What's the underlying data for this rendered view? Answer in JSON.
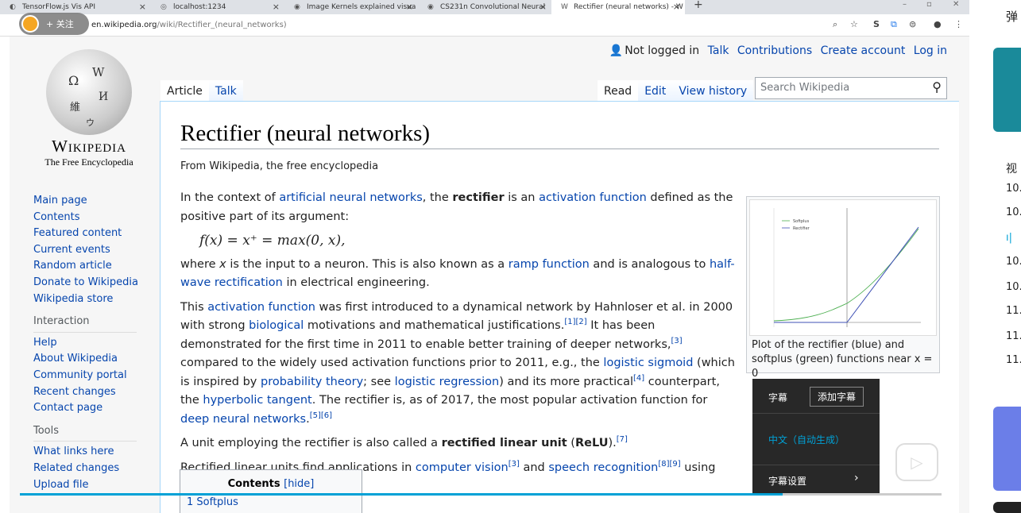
{
  "browser": {
    "tabs": [
      {
        "label": "TensorFlow.js Vis API",
        "fav": "◐"
      },
      {
        "label": "localhost:1234",
        "fav": "◎"
      },
      {
        "label": "Image Kernels explained visua",
        "fav": "◉"
      },
      {
        "label": "CS231n Convolutional Neural",
        "fav": "◉"
      },
      {
        "label": "Rectifier (neural networks) - W",
        "fav": "W"
      }
    ],
    "url_domain": "en.wikipedia.org",
    "url_path": "/wiki/Rectifier_(neural_networks)",
    "follow_label": "+ 关注"
  },
  "wiki": {
    "wordmark": "Wikipedia",
    "tagline": "The Free Encyclopedia",
    "nav": [
      "Main page",
      "Contents",
      "Featured content",
      "Current events",
      "Random article",
      "Donate to Wikipedia",
      "Wikipedia store"
    ],
    "interaction_head": "Interaction",
    "interaction": [
      "Help",
      "About Wikipedia",
      "Community portal",
      "Recent changes",
      "Contact page"
    ],
    "tools_head": "Tools",
    "tools": [
      "What links here",
      "Related changes",
      "Upload file"
    ],
    "personal": {
      "not_logged": "Not logged in",
      "talk": "Talk",
      "contrib": "Contributions",
      "create": "Create account",
      "login": "Log in"
    },
    "tab_article": "Article",
    "tab_talk": "Talk",
    "tab_read": "Read",
    "tab_edit": "Edit",
    "tab_history": "View history",
    "search_placeholder": "Search Wikipedia",
    "title": "Rectifier (neural networks)",
    "from": "From Wikipedia, the free encyclopedia",
    "formula": "f(x) = x⁺ = max(0, x),",
    "caption": "Plot of the rectifier (blue) and softplus (green) functions near x = 0",
    "toc_title": "Contents",
    "toc_hide": "[hide]",
    "toc_item": "1  Softplus"
  },
  "overlay": {
    "subtitle": "字幕",
    "add_subtitle": "添加字幕",
    "auto_zh": "中文（自动生成）",
    "subtitle_settings": "字幕设置"
  },
  "sidepanel": {
    "items": [
      "弹",
      "视",
      "10.",
      "10.",
      "10.",
      "10.",
      "11.",
      "11.",
      "11."
    ]
  },
  "colors": {
    "link": "#0645ad",
    "accent": "#00a1d6"
  }
}
